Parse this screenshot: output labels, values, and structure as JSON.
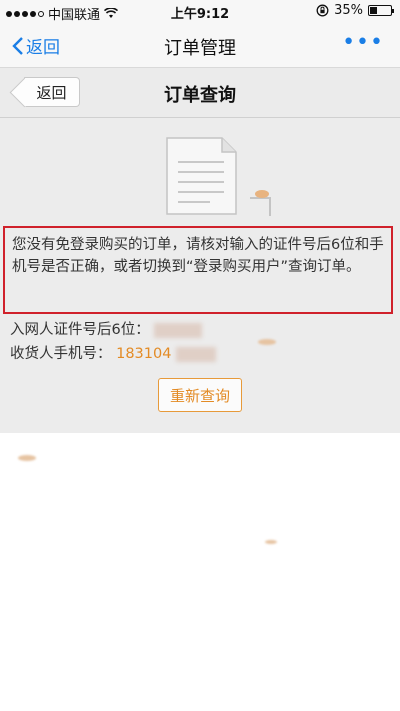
{
  "statusbar": {
    "carrier": "中国联通",
    "time": "上午9:12",
    "battery": "35%",
    "battery_level": 0.35,
    "wifi_icon": "wifi-icon",
    "lock_icon": "rotation-lock-icon"
  },
  "navbar": {
    "back_label": "返回",
    "title": "订单管理",
    "more_icon": "more-dots-icon"
  },
  "subbar": {
    "back_label": "返回",
    "title": "订单查询"
  },
  "main": {
    "message": "您没有免登录购买的订单，请核对输入的证件号后6位和手机号是否正确，或者切换到“登录购买用户”查询订单。",
    "id_label": "入网人证件号后6位：",
    "phone_label": "收货人手机号：",
    "phone_value": "183104",
    "requery_label": "重新查询"
  },
  "colors": {
    "accent_blue": "#1a7ee6",
    "accent_orange": "#e38b25",
    "highlight_red": "#d0212b"
  }
}
